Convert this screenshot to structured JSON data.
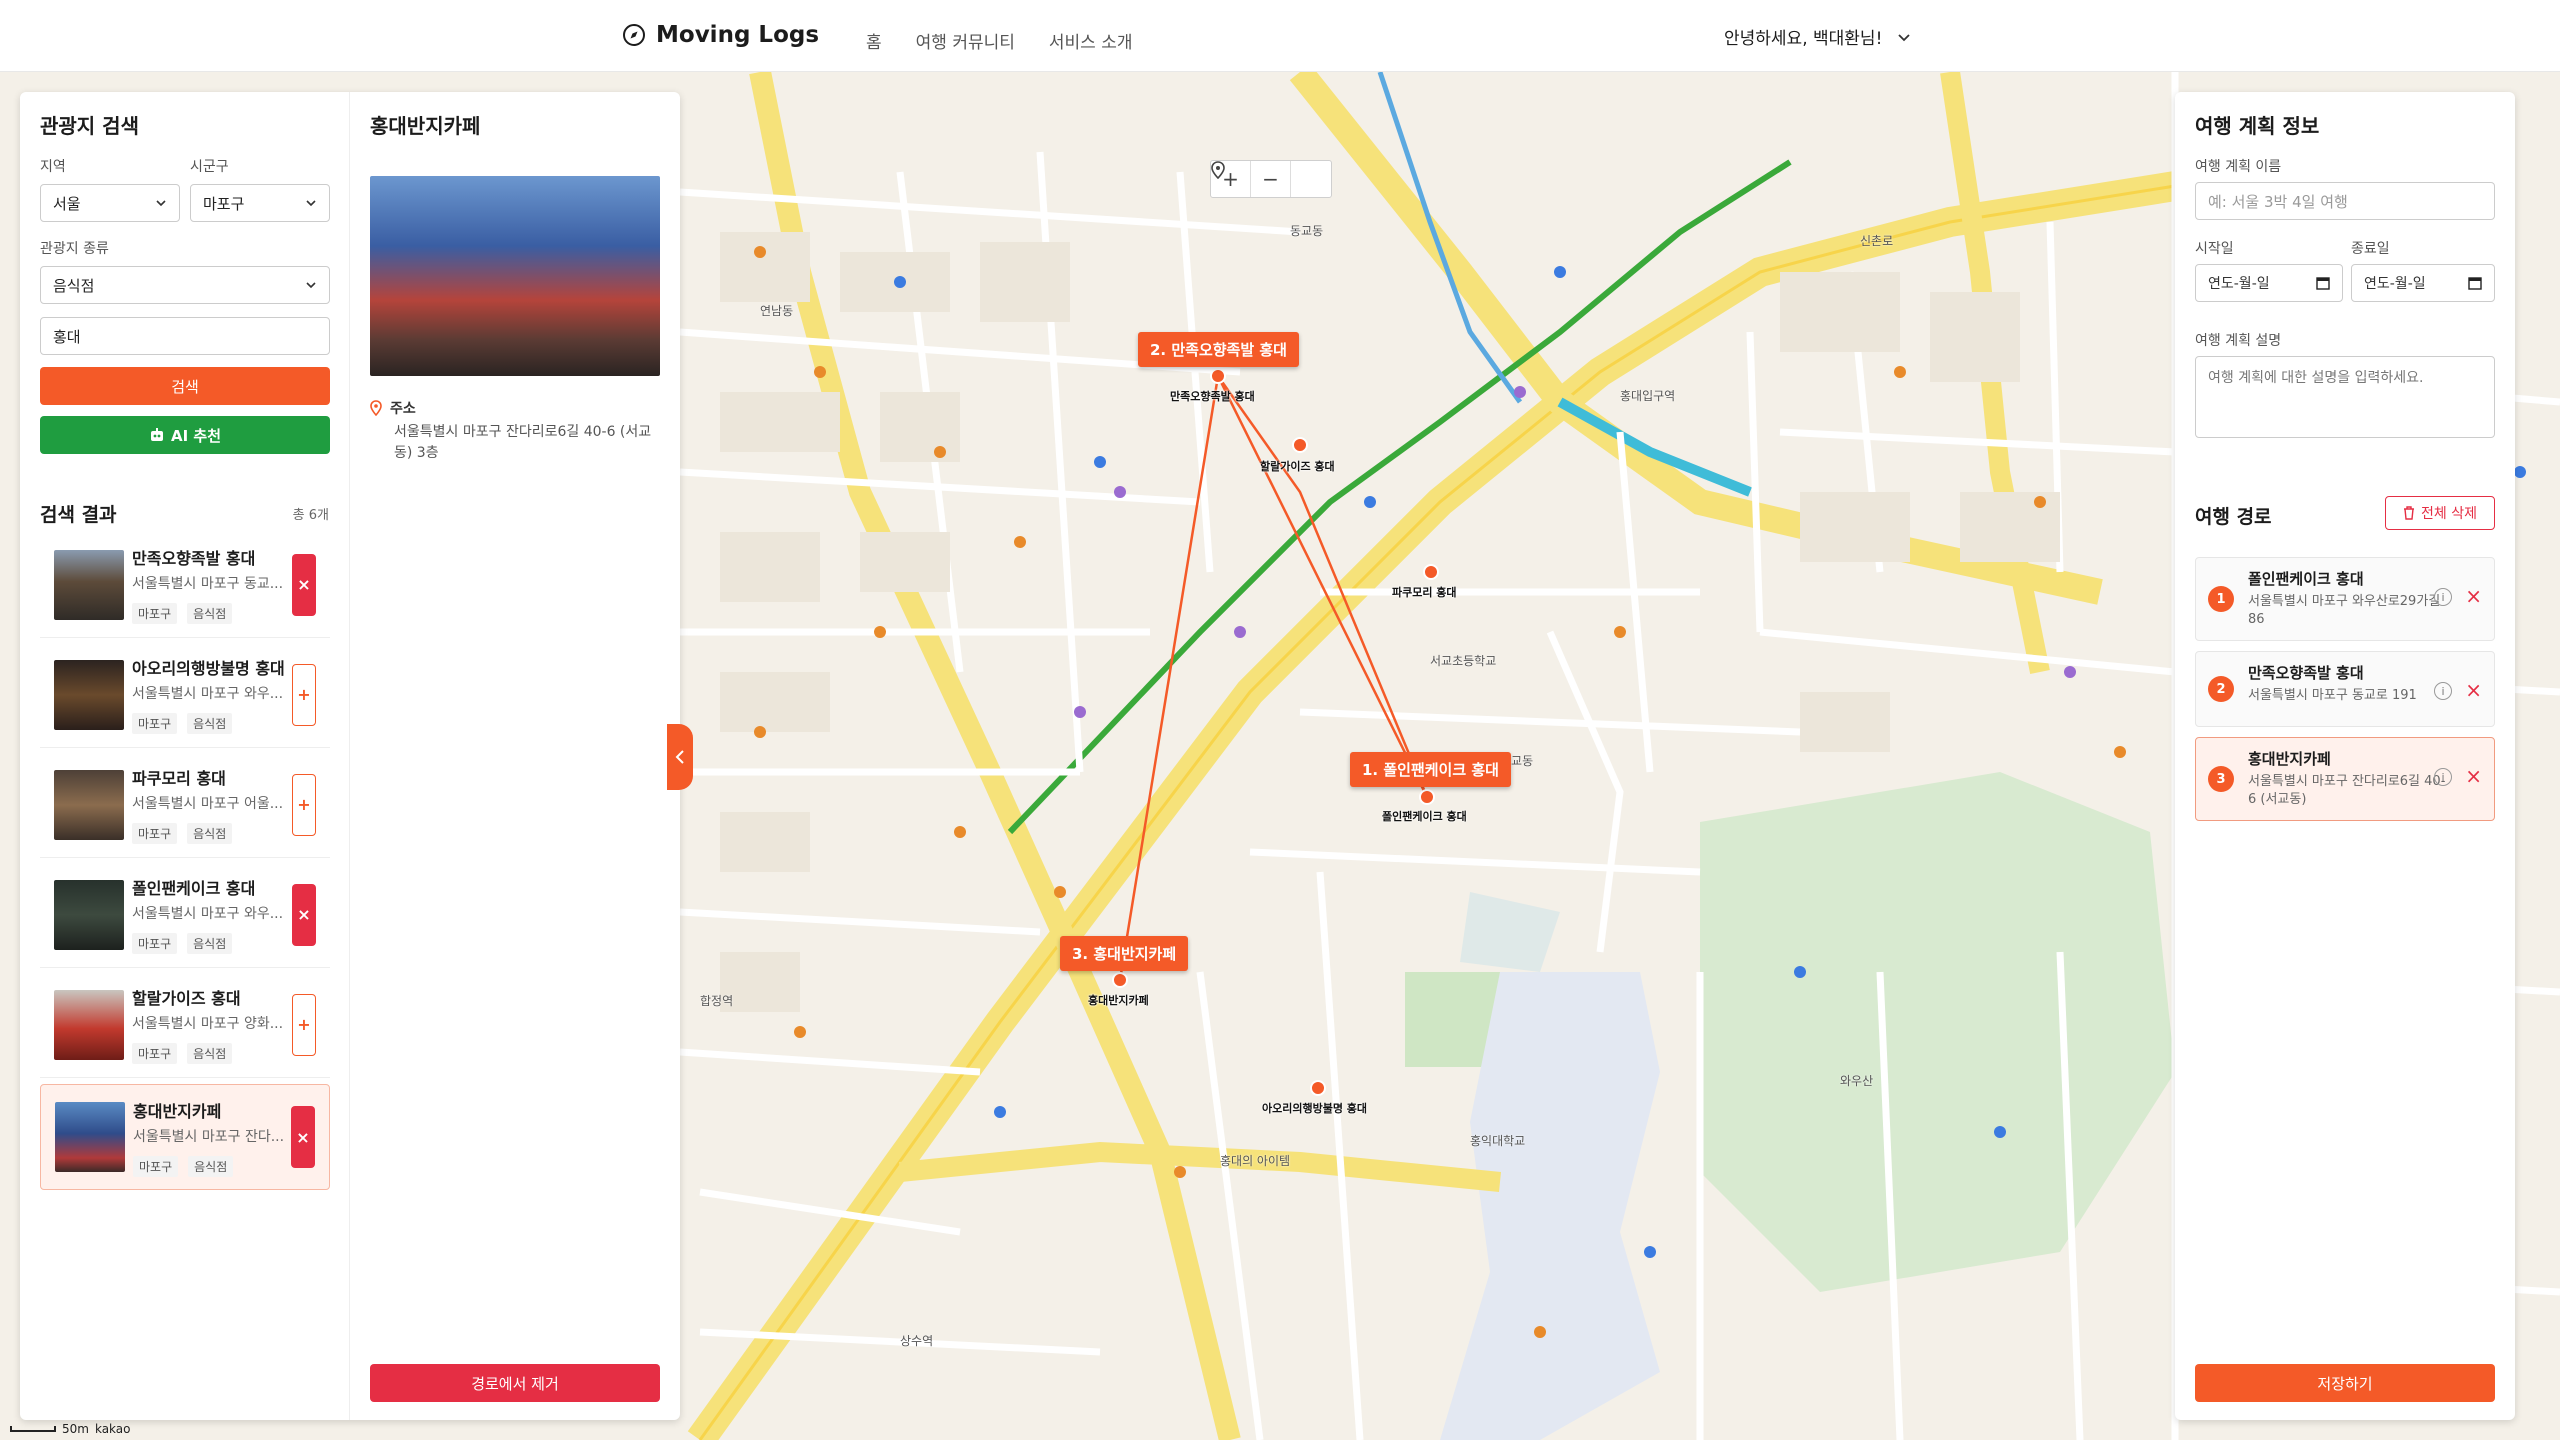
{
  "header": {
    "logo": "Moving Logs",
    "nav": [
      "홈",
      "여행 커뮤니티",
      "서비스 소개"
    ],
    "greeting": "안녕하세요, 백대환님!"
  },
  "search": {
    "title": "관광지 검색",
    "region_label": "지역",
    "region_value": "서울",
    "district_label": "시군구",
    "district_value": "마포구",
    "type_label": "관광지 종류",
    "type_value": "음식점",
    "keyword_value": "홍대",
    "search_button": "검색",
    "ai_button": "AI 추천",
    "results_title": "검색 결과",
    "results_count": "총 6개",
    "results": [
      {
        "name": "만족오향족발 홍대",
        "address": "서울특별시 마포구 동교...",
        "tags": [
          "마포구",
          "음식점"
        ],
        "action": "×"
      },
      {
        "name": "아오리의행방불명 홍대",
        "address": "서울특별시 마포구 와우...",
        "tags": [
          "마포구",
          "음식점"
        ],
        "action": "+"
      },
      {
        "name": "파쿠모리 홍대",
        "address": "서울특별시 마포구 어울...",
        "tags": [
          "마포구",
          "음식점"
        ],
        "action": "+"
      },
      {
        "name": "폴인팬케이크 홍대",
        "address": "서울특별시 마포구 와우...",
        "tags": [
          "마포구",
          "음식점"
        ],
        "action": "×"
      },
      {
        "name": "할랄가이즈 홍대",
        "address": "서울특별시 마포구 양화...",
        "tags": [
          "마포구",
          "음식점"
        ],
        "action": "+"
      },
      {
        "name": "홍대반지카페",
        "address": "서울특별시 마포구 잔다...",
        "tags": [
          "마포구",
          "음식점"
        ],
        "action": "×"
      }
    ]
  },
  "detail": {
    "title": "홍대반지카페",
    "address_label": "주소",
    "address": "서울특별시 마포구 잔다리로6길 40-6 (서교동) 3층",
    "remove_button": "경로에서 제거"
  },
  "plan": {
    "title": "여행 계획 정보",
    "name_label": "여행 계획 이름",
    "name_placeholder": "예: 서울 3박 4일 여행",
    "start_label": "시작일",
    "end_label": "종료일",
    "date_placeholder": "연도-월-일",
    "desc_label": "여행 계획 설명",
    "desc_placeholder": "여행 계획에 대한 설명을 입력하세요.",
    "route_title": "여행 경로",
    "delete_all": "전체 삭제",
    "route": [
      {
        "num": "1",
        "name": "폴인팬케이크 홍대",
        "address": "서울특별시 마포구 와우산로29가길 86"
      },
      {
        "num": "2",
        "name": "만족오향족발 홍대",
        "address": "서울특별시 마포구 동교로 191"
      },
      {
        "num": "3",
        "name": "홍대반지카페",
        "address": "서울특별시 마포구 잔다리로6길 40-6 (서교동)"
      }
    ],
    "save_button": "저장하기"
  },
  "map": {
    "pins": [
      {
        "label": "1. 폴인팬케이크 홍대",
        "name": "폴인팬케이크 홍대"
      },
      {
        "label": "2. 만족오향족발 홍대",
        "name": "만족오향족발 홍대"
      },
      {
        "label": "3. 홍대반지카페",
        "name": "홍대반지카페"
      }
    ],
    "other_pins": [
      "할랄가이즈 홍대",
      "파쿠모리 홍대",
      "아오리의행방불명 홍대"
    ],
    "places": [
      "홍대입구역",
      "와우산",
      "서교초등학교",
      "홍대의 아이템",
      "신촌로",
      "동교동",
      "연남동",
      "서교동",
      "합정역",
      "상수역",
      "홍익대학교"
    ],
    "scale": "50m",
    "brand": "kakao",
    "route_color": "#f45a28",
    "accent": "#f45a28",
    "green": "#1f9d40",
    "danger": "#e52e44"
  }
}
